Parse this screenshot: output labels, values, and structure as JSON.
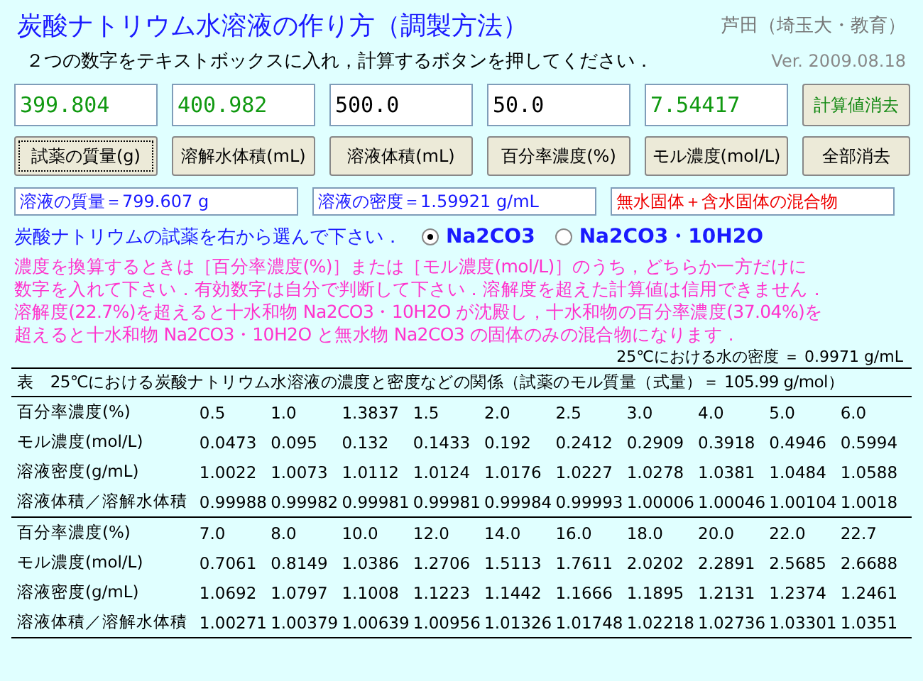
{
  "title": "炭酸ナトリウム水溶液の作り方（調製方法）",
  "author": "芦田（埼玉大・教育）",
  "instruction": "２つの数字をテキストボックスに入れ，計算するボタンを押してください．",
  "version": "Ver. 2009.08.18",
  "fields": [
    {
      "value": "399.804",
      "computed": true
    },
    {
      "value": "400.982",
      "computed": true
    },
    {
      "value": "500.0",
      "computed": false
    },
    {
      "value": "50.0",
      "computed": false
    },
    {
      "value": "7.54417",
      "computed": true
    }
  ],
  "clear_computed_button": {
    "label": "計算値消去"
  },
  "buttons": [
    {
      "label": "試薬の質量(g)",
      "focused": true
    },
    {
      "label": "溶解水体積(mL)",
      "focused": false
    },
    {
      "label": "溶液体積(mL)",
      "focused": false
    },
    {
      "label": "百分率濃度(%)",
      "focused": false
    },
    {
      "label": "モル濃度(mol/L)",
      "focused": false
    },
    {
      "label": "全部消去",
      "focused": false
    }
  ],
  "results": [
    {
      "text": "溶液の質量＝799.607 g",
      "kind": "value"
    },
    {
      "text": "溶液の密度＝1.59921 g/mL",
      "kind": "value"
    },
    {
      "text": "無水固体＋含水固体の混合物",
      "kind": "warning"
    }
  ],
  "reagent_prompt": "炭酸ナトリウムの試薬を右から選んで下さい．",
  "reagents": [
    {
      "label": "Na2CO3",
      "selected": true
    },
    {
      "label": "Na2CO3・10H2O",
      "selected": false
    }
  ],
  "note_lines": [
    "濃度を換算するときは［百分率濃度(%)］または［モル濃度(mol/L)］のうち，どちらか一方だけに",
    "数字を入れて下さい．有効数字は自分で判断して下さい．溶解度を超えた計算値は信用できません．",
    "溶解度(22.7%)を超えると十水和物 Na2CO3・10H2O が沈殿し，十水和物の百分率濃度(37.04%)を",
    "超えると十水和物 Na2CO3・10H2O と無水物 Na2CO3 の固体のみの混合物になります．"
  ],
  "water_density": "25℃における水の密度 ＝ 0.9971 g/mL",
  "table": {
    "caption": "表　25℃における炭酸ナトリウム水溶液の濃度と密度などの関係（試薬のモル質量（式量）＝ 105.99 g/mol）",
    "blocks": [
      {
        "rows": [
          {
            "label": "百分率濃度(%)",
            "cells": [
              "0.5",
              "1.0",
              "1.3837",
              "1.5",
              "2.0",
              "2.5",
              "3.0",
              "4.0",
              "5.0",
              "6.0"
            ]
          },
          {
            "label": "モル濃度(mol/L)",
            "cells": [
              "0.0473",
              "0.095",
              "0.132",
              "0.1433",
              "0.192",
              "0.2412",
              "0.2909",
              "0.3918",
              "0.4946",
              "0.5994"
            ]
          },
          {
            "label": "溶液密度(g/mL)",
            "cells": [
              "1.0022",
              "1.0073",
              "1.0112",
              "1.0124",
              "1.0176",
              "1.0227",
              "1.0278",
              "1.0381",
              "1.0484",
              "1.0588"
            ]
          },
          {
            "label": "溶液体積／溶解水体積",
            "cells": [
              "0.99988",
              "0.99982",
              "0.99981",
              "0.99981",
              "0.99984",
              "0.99993",
              "1.00006",
              "1.00046",
              "1.00104",
              "1.0018"
            ]
          }
        ]
      },
      {
        "rows": [
          {
            "label": "百分率濃度(%)",
            "cells": [
              "7.0",
              "8.0",
              "10.0",
              "12.0",
              "14.0",
              "16.0",
              "18.0",
              "20.0",
              "22.0",
              "22.7"
            ]
          },
          {
            "label": "モル濃度(mol/L)",
            "cells": [
              "0.7061",
              "0.8149",
              "1.0386",
              "1.2706",
              "1.5113",
              "1.7611",
              "2.0202",
              "2.2891",
              "2.5685",
              "2.6688"
            ]
          },
          {
            "label": "溶液密度(g/mL)",
            "cells": [
              "1.0692",
              "1.0797",
              "1.1008",
              "1.1223",
              "1.1442",
              "1.1666",
              "1.1895",
              "1.2131",
              "1.2374",
              "1.2461"
            ]
          },
          {
            "label": "溶液体積／溶解水体積",
            "cells": [
              "1.00271",
              "1.00379",
              "1.00639",
              "1.00956",
              "1.01326",
              "1.01748",
              "1.02218",
              "1.02736",
              "1.03301",
              "1.0351"
            ]
          }
        ]
      }
    ]
  }
}
